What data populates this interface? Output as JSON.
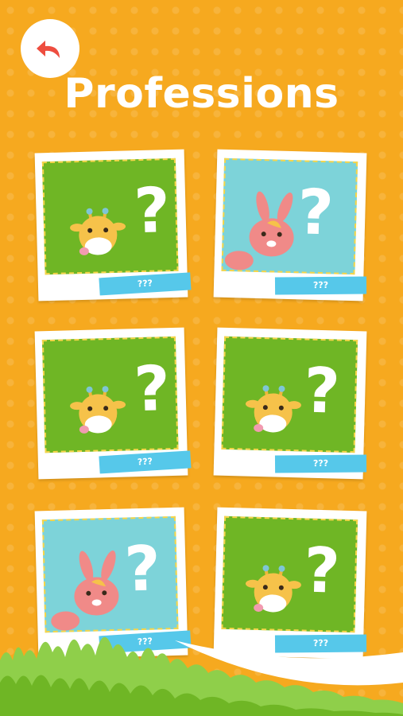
{
  "header": {
    "title": "Professions"
  },
  "cards": [
    {
      "label": "???",
      "animal": "giraffe",
      "bg": "#6fb625"
    },
    {
      "label": "???",
      "animal": "bunny",
      "bg": "#7dd3d9"
    },
    {
      "label": "???",
      "animal": "giraffe",
      "bg": "#6fb625"
    },
    {
      "label": "???",
      "animal": "giraffe",
      "bg": "#6fb625"
    },
    {
      "label": "???",
      "animal": "bunny",
      "bg": "#7dd3d9"
    },
    {
      "label": "???",
      "animal": "giraffe",
      "bg": "#6fb625"
    }
  ],
  "icons": {
    "back": "back-arrow-icon"
  },
  "colors": {
    "background": "#f6a91f",
    "back_arrow": "#ee4d3f",
    "label": "#56c8ea"
  }
}
